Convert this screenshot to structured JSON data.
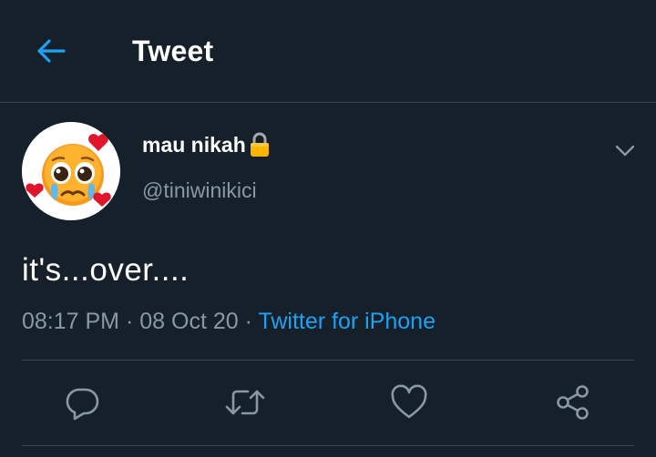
{
  "header": {
    "title": "Tweet",
    "back_icon": "arrow-left-icon"
  },
  "tweet": {
    "display_name": "mau nikah",
    "lock_icon": "lock-icon",
    "handle": "@tiniwinikici",
    "text": "it's...over....",
    "time": "08:17 PM",
    "separator": "·",
    "date": "08 Oct 20",
    "source": "Twitter for iPhone"
  },
  "actions": {
    "icons": [
      "reply-icon",
      "retweet-icon",
      "like-icon",
      "share-icon"
    ]
  },
  "colors": {
    "background": "#15202b",
    "accent": "#1da1f2",
    "secondary_text": "#8899a6",
    "divider": "#38444d"
  }
}
